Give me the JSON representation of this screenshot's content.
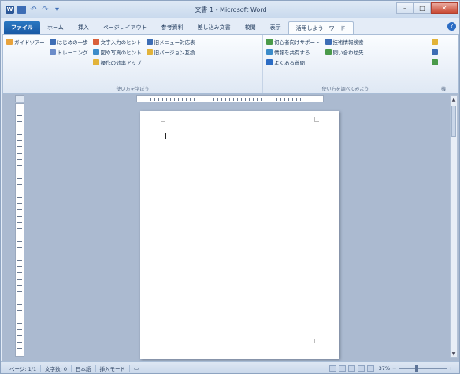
{
  "window": {
    "title": "文書 1 - Microsoft Word",
    "min": "–",
    "max": "□",
    "close": "✕"
  },
  "qat": {
    "undo": "↶",
    "redo": "↷",
    "dropdown": "▾"
  },
  "tabs": [
    {
      "label": "ファイル",
      "kind": "file"
    },
    {
      "label": "ホーム",
      "kind": ""
    },
    {
      "label": "挿入",
      "kind": ""
    },
    {
      "label": "ページレイアウト",
      "kind": ""
    },
    {
      "label": "参考資料",
      "kind": ""
    },
    {
      "label": "差し込み文書",
      "kind": ""
    },
    {
      "label": "校閲",
      "kind": ""
    },
    {
      "label": "表示",
      "kind": ""
    },
    {
      "label": "活用しよう！ワード",
      "kind": "active"
    }
  ],
  "ribbon": {
    "group1": {
      "label": "使い方を学ぼう",
      "col1": [
        {
          "label": "ガイドツアー",
          "color": "#e8a33c"
        }
      ],
      "col2": [
        {
          "label": "はじめの一歩",
          "color": "#3d6db5"
        },
        {
          "label": "トレーニング",
          "color": "#6b8cc9"
        }
      ],
      "col3": [
        {
          "label": "文字入力のヒント",
          "color": "#d95f3a"
        },
        {
          "label": "図や写真のヒント",
          "color": "#3b8bc9"
        },
        {
          "label": "操作の効率アップ",
          "color": "#e2b33a"
        }
      ],
      "col4": [
        {
          "label": "旧メニュー対応表",
          "color": "#3d6db5"
        },
        {
          "label": "旧バージョン互換",
          "color": "#e2b33a"
        }
      ]
    },
    "group2": {
      "label": "使い方を調べてみよう",
      "col1": [
        {
          "label": "初心者向けサポート",
          "color": "#4a9a4a"
        },
        {
          "label": "情報を共有する",
          "color": "#3b8bc9"
        },
        {
          "label": "よくある質問",
          "color": "#2b6cc4"
        }
      ],
      "col2": [
        {
          "label": "技術情報検索",
          "color": "#3d6db5"
        },
        {
          "label": "問い合わせ先",
          "color": "#4a9a4a"
        }
      ]
    },
    "group3": {
      "label": "機"
    }
  },
  "status": {
    "page": "ページ: 1/1",
    "words": "文字数: 0",
    "language": "日本語",
    "mode": "挿入モード",
    "zoom_pct": "37%",
    "zoom_minus": "−",
    "zoom_plus": "+",
    "zoom_fraction": 0.37
  }
}
